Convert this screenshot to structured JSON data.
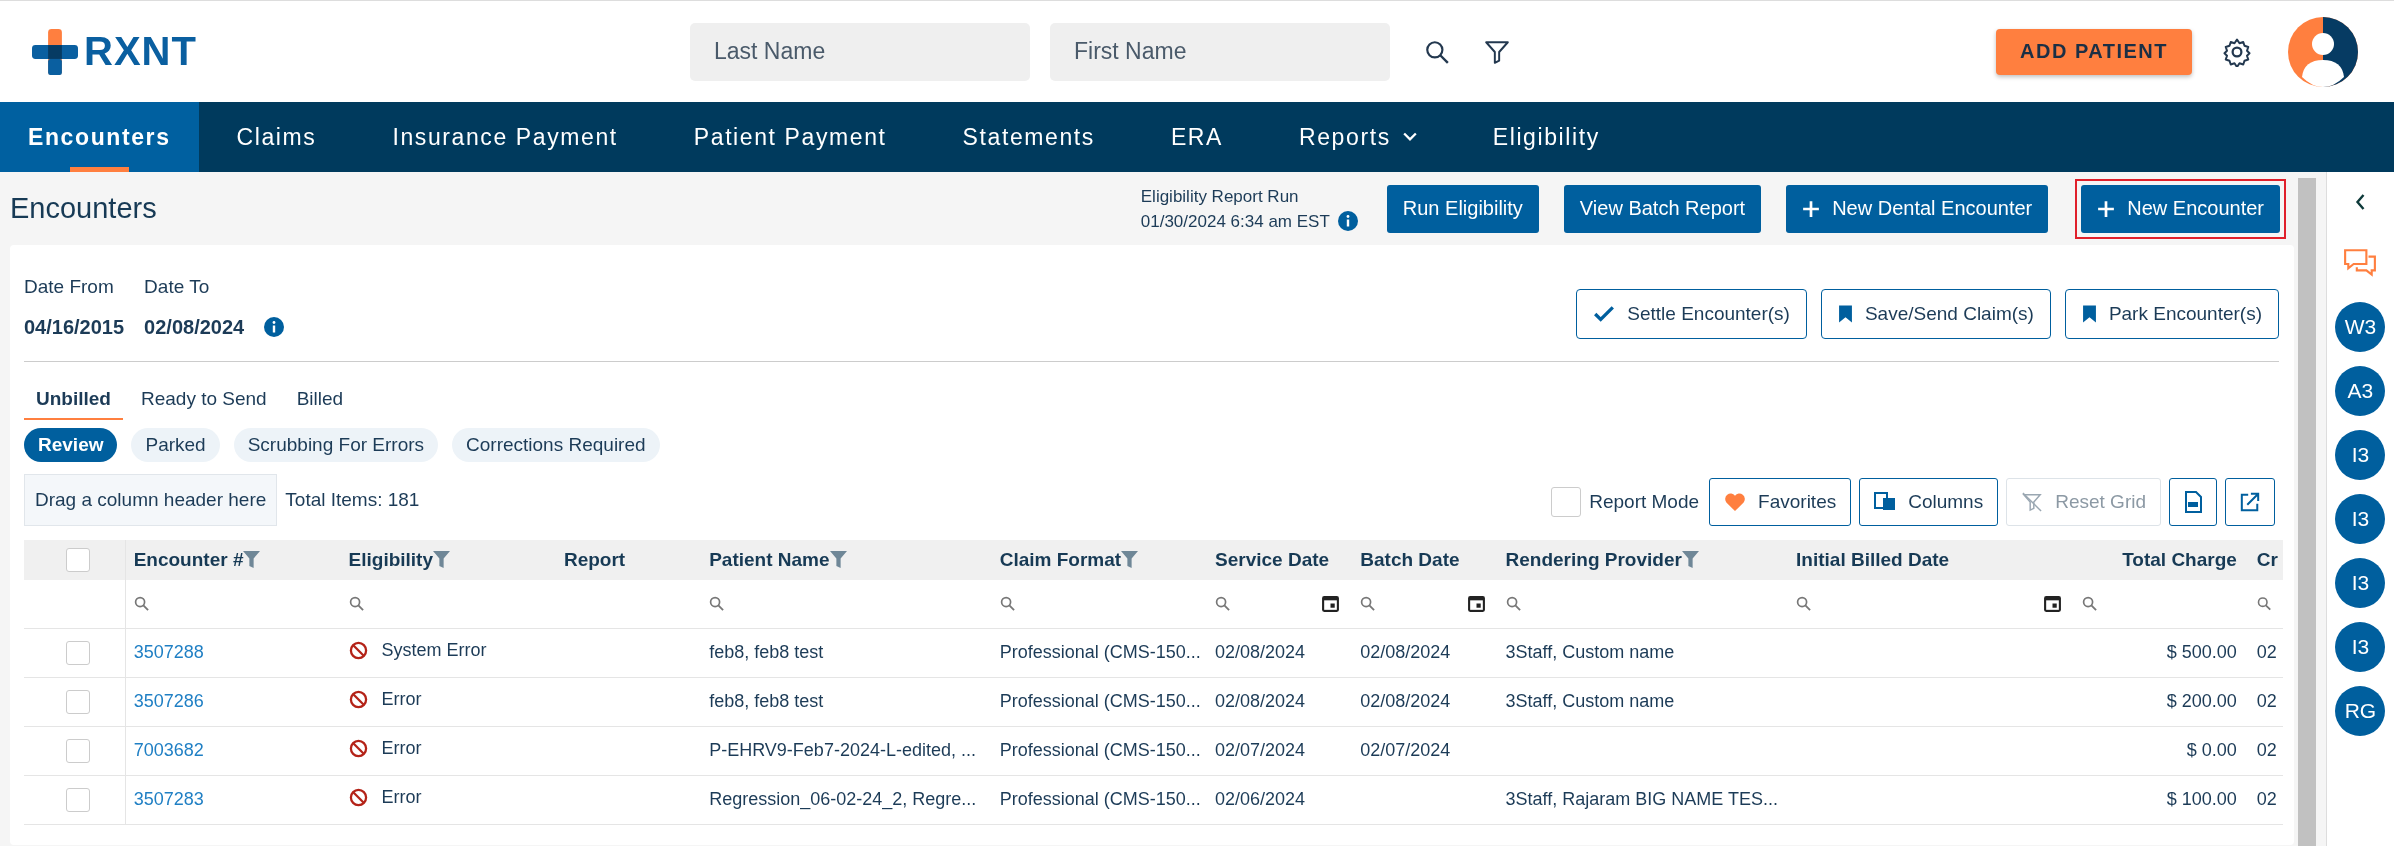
{
  "header": {
    "logo": "RXNT",
    "search_fields": [
      {
        "placeholder": "Last Name"
      },
      {
        "placeholder": "First Name"
      }
    ],
    "add_patient": "ADD PATIENT"
  },
  "nav": [
    {
      "label": "Encounters",
      "selected": true,
      "dropdown": false
    },
    {
      "label": "Claims",
      "selected": false,
      "dropdown": false
    },
    {
      "label": "Insurance Payment",
      "selected": false,
      "dropdown": false
    },
    {
      "label": "Patient Payment",
      "selected": false,
      "dropdown": false
    },
    {
      "label": "Statements",
      "selected": false,
      "dropdown": false
    },
    {
      "label": "ERA",
      "selected": false,
      "dropdown": false
    },
    {
      "label": "Reports",
      "selected": false,
      "dropdown": true
    },
    {
      "label": "Eligibility",
      "selected": false,
      "dropdown": false
    }
  ],
  "page": {
    "title": "Encounters",
    "report_run": {
      "label": "Eligibility Report Run",
      "time": "01/30/2024 6:34 am EST"
    },
    "actions": [
      {
        "label": "Run Eligibility",
        "kind": "plain",
        "highlighted": false
      },
      {
        "label": "View Batch Report",
        "kind": "plain",
        "highlighted": false
      },
      {
        "label": "New Dental Encounter",
        "kind": "create",
        "highlighted": false
      },
      {
        "label": "New Encounter",
        "kind": "create",
        "highlighted": true
      }
    ]
  },
  "filters": {
    "date_from": {
      "label": "Date From",
      "value": "04/16/2015"
    },
    "date_to": {
      "label": "Date To",
      "value": "02/08/2024"
    }
  },
  "bulk_actions": [
    {
      "label": "Settle Encounter(s)",
      "kind": "settle"
    },
    {
      "label": "Save/Send Claim(s)",
      "kind": "save"
    },
    {
      "label": "Park Encounter(s)",
      "kind": "park"
    }
  ],
  "status_tabs": [
    {
      "label": "Unbilled",
      "selected": true
    },
    {
      "label": "Ready to Send",
      "selected": false
    },
    {
      "label": "Billed",
      "selected": false
    }
  ],
  "sub_filters": [
    {
      "label": "Review",
      "selected": true
    },
    {
      "label": "Parked",
      "selected": false
    },
    {
      "label": "Scrubbing For Errors",
      "selected": false
    },
    {
      "label": "Corrections Required",
      "selected": false
    }
  ],
  "grid": {
    "group_hint": "Drag a column header here",
    "total": "Total Items: 181",
    "report_mode": {
      "label": "Report Mode",
      "checked": false
    },
    "tools": [
      {
        "kind": "favorites",
        "label": "Favorites",
        "disabled": false
      },
      {
        "kind": "columns",
        "label": "Columns",
        "disabled": false
      },
      {
        "kind": "reset",
        "label": "Reset Grid",
        "disabled": true
      },
      {
        "kind": "pdf",
        "disabled": false
      },
      {
        "kind": "export",
        "disabled": false
      }
    ]
  },
  "table": {
    "header_checked": false,
    "columns": [
      {
        "label": "Encounter #",
        "kind": "link",
        "filter": true
      },
      {
        "label": "Eligibility",
        "kind": "status",
        "filter": true
      },
      {
        "label": "Report",
        "kind": "plain",
        "filter": false
      },
      {
        "label": "Patient Name",
        "kind": "text",
        "filter": true
      },
      {
        "label": "Claim Format",
        "kind": "text",
        "filter": true
      },
      {
        "label": "Service Date",
        "kind": "date",
        "filter": false
      },
      {
        "label": "Batch Date",
        "kind": "date",
        "filter": false
      },
      {
        "label": "Rendering Provider",
        "kind": "text",
        "filter": true
      },
      {
        "label": "Initial Billed Date",
        "kind": "date",
        "filter": false
      },
      {
        "label": "Total Charge",
        "kind": "money",
        "filter": false
      },
      {
        "label": "Cr",
        "kind": "text",
        "filter": false
      }
    ],
    "rows": [
      {
        "checked": false,
        "cells": [
          "3507288",
          "System Error",
          null,
          "feb8, feb8 test",
          "Professional (CMS-150...",
          "02/08/2024",
          "02/08/2024",
          "3Staff, Custom name",
          null,
          "$ 500.00",
          "02"
        ]
      },
      {
        "checked": false,
        "cells": [
          "3507286",
          "Error",
          null,
          "feb8, feb8 test",
          "Professional (CMS-150...",
          "02/08/2024",
          "02/08/2024",
          "3Staff, Custom name",
          null,
          "$ 200.00",
          "02"
        ]
      },
      {
        "checked": false,
        "cells": [
          "7003682",
          "Error",
          null,
          "P-EHRV9-Feb7-2024-L-edited, ...",
          "Professional (CMS-150...",
          "02/07/2024",
          "02/07/2024",
          null,
          null,
          "$ 0.00",
          "02"
        ]
      },
      {
        "checked": false,
        "cells": [
          "3507283",
          "Error",
          null,
          "Regression_06-02-24_2, Regre...",
          "Professional (CMS-150...",
          "02/06/2024",
          null,
          "3Staff, Rajaram BIG NAME TES...",
          null,
          "$ 100.00",
          "02"
        ]
      }
    ]
  },
  "sidebar": {
    "avatars": [
      "W3",
      "A3",
      "I3",
      "I3",
      "I3",
      "I3",
      "RG"
    ]
  }
}
